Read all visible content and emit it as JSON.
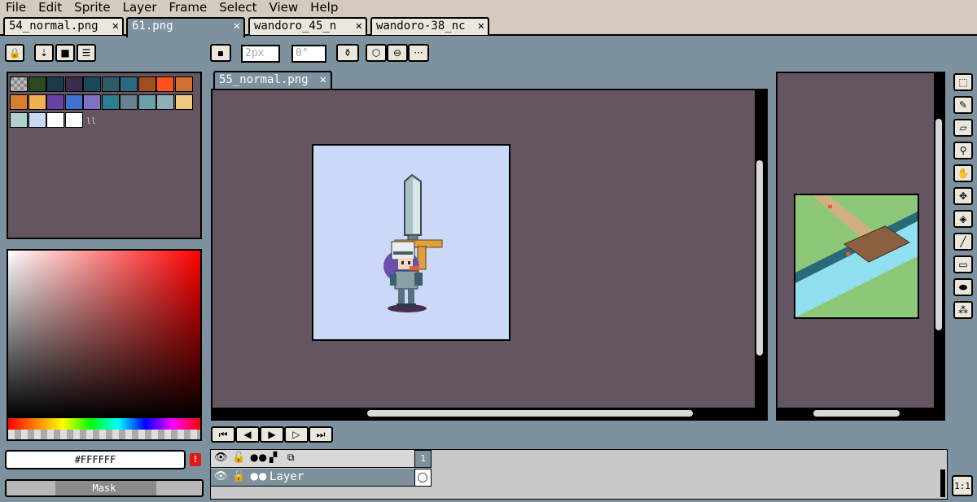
{
  "menu": [
    "File",
    "Edit",
    "Sprite",
    "Layer",
    "Frame",
    "Select",
    "View",
    "Help"
  ],
  "file_tabs": [
    {
      "label": "54_normal.png",
      "close": "✕"
    },
    {
      "label": "61.png",
      "close": "✕"
    },
    {
      "label": "wandoro_45_n",
      "close": "✕"
    },
    {
      "label": "wandoro-38_nc",
      "close": "✕"
    }
  ],
  "toolbar": {
    "brush_size": "2px",
    "angle": "0°"
  },
  "sub_tab": {
    "label": "55_normal.png",
    "close": "✕"
  },
  "palette": [
    "#c0c0c0",
    "#2b4a20",
    "#1c3a4a",
    "#3a2f4a",
    "#1a4a5a",
    "#2f5a6a",
    "#2a6a80",
    "#a05020",
    "#ff5020",
    "#d07030",
    "#d48030",
    "#f0b050",
    "#6a40a0",
    "#4070d0",
    "#8070c0",
    "#2a8090",
    "#6a8090",
    "#6aa0a8",
    "#90b0b8",
    "#f0c880",
    "#b0d0d0",
    "#c8d8f0",
    "#ffffff",
    "#ffffff"
  ],
  "color": {
    "hex": "#FFFFFF",
    "warning": "!",
    "mask": "Mask",
    "hue_gradient": [
      "#ff0000",
      "#ff8000",
      "#ffff00",
      "#00ff00",
      "#00ffff",
      "#0000ff",
      "#ff00ff",
      "#ff0000"
    ]
  },
  "timeline": {
    "frame_number": "1",
    "layer_name": "Layer"
  },
  "zoom_button": "1:1",
  "colors": {
    "canvas_bg": "#655560",
    "sprite_bg": "#ccd8f8",
    "ui_bg": "#7d929e",
    "menu_bg": "#d3cbbe"
  }
}
